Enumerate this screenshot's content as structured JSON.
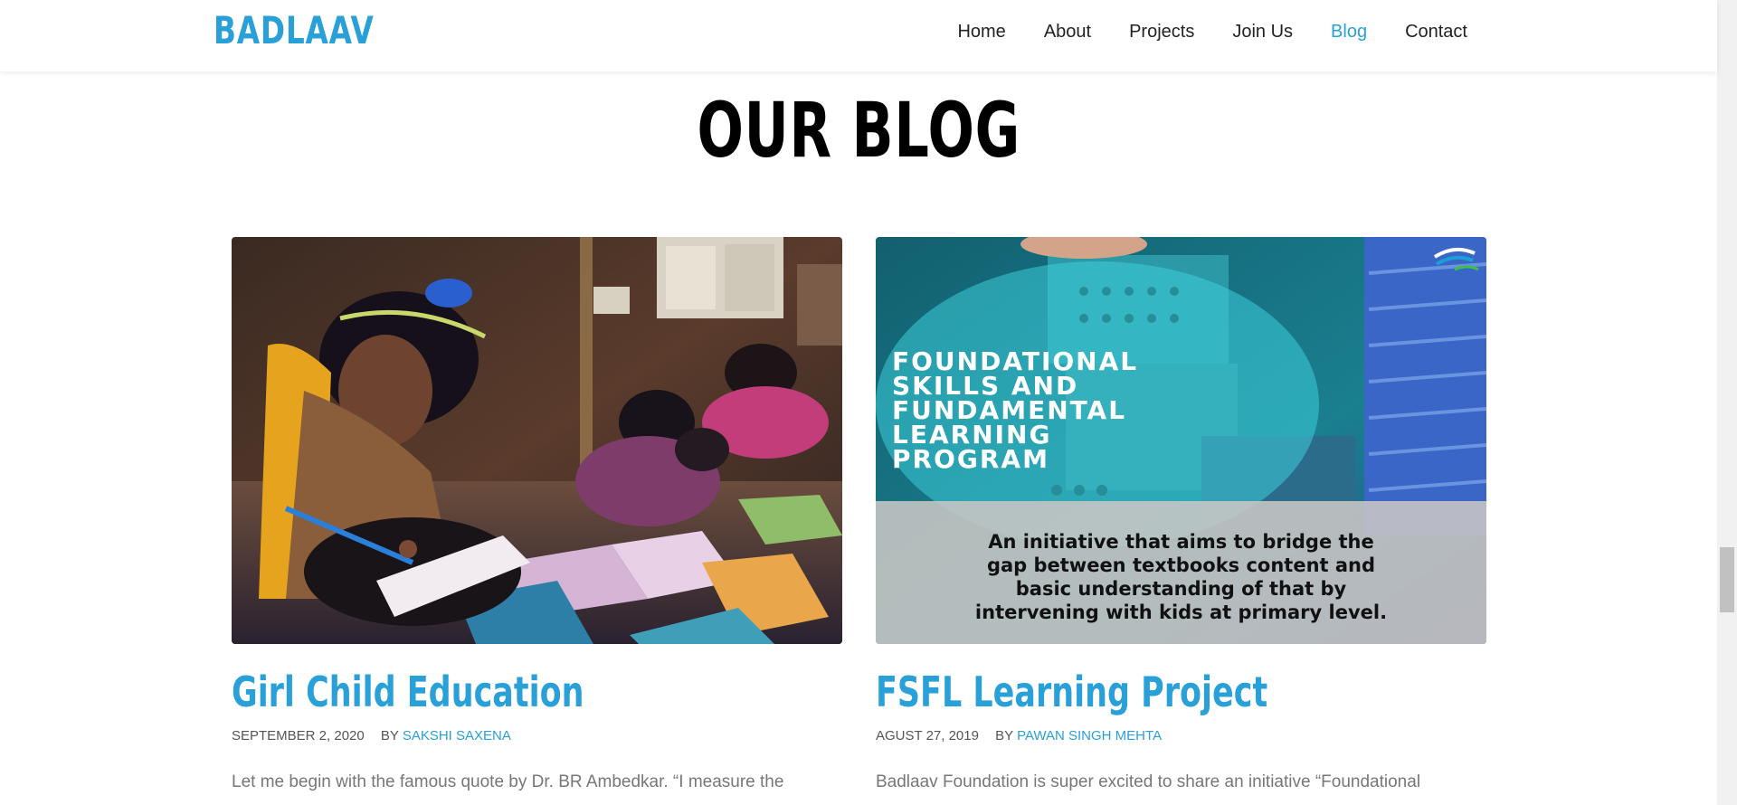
{
  "header": {
    "logo": "BADLAAV",
    "nav": [
      {
        "label": "Home",
        "active": false
      },
      {
        "label": "About",
        "active": false
      },
      {
        "label": "Projects",
        "active": false
      },
      {
        "label": "Join Us",
        "active": false
      },
      {
        "label": "Blog",
        "active": true
      },
      {
        "label": "Contact",
        "active": false
      }
    ]
  },
  "section": {
    "title": "OUR BLOG"
  },
  "posts": [
    {
      "title": "Girl Child Education",
      "date": "SEPTEMBER 2, 2020",
      "by": "BY",
      "author": "SAKSHI SAXENA",
      "excerpt": "Let me begin with the famous quote by Dr. BR Ambedkar. “I measure the"
    },
    {
      "title": "FSFL Learning Project",
      "date": "AGUST 27, 2019",
      "by": "BY",
      "author": "PAWAN SINGH MEHTA",
      "excerpt": "Badlaav Foundation is super excited to share an initiative “Foundational",
      "image_text": {
        "heading_lines": [
          "FOUNDATIONAL",
          "SKILLS AND",
          "FUNDAMENTAL",
          "LEARNING",
          "PROGRAM"
        ],
        "caption_lines": [
          "An initiative that aims to bridge the",
          "gap between textbooks content and",
          "basic understanding of that by",
          "intervening with kids at primary level."
        ]
      }
    }
  ],
  "colors": {
    "accent": "#2aa0d8",
    "title": "#000000",
    "text": "#777777"
  }
}
